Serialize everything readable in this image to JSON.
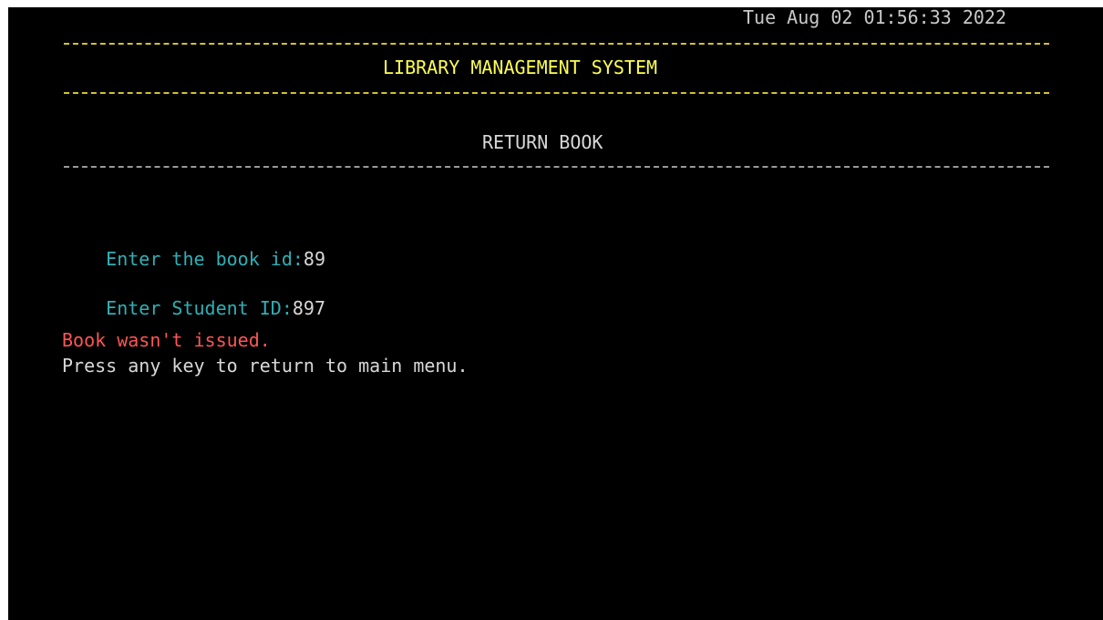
{
  "header": {
    "datetime": "Tue Aug 02 01:56:33 2022",
    "app_title": "LIBRARY MANAGEMENT SYSTEM",
    "screen_title": "RETURN BOOK"
  },
  "form": {
    "book_id_prompt": "Enter the book id:",
    "book_id_value": "89",
    "student_id_prompt": "Enter Student ID:",
    "student_id_value": "897"
  },
  "messages": {
    "error": "Book wasn't issued.",
    "continue_prompt": "Press any key to return to main menu."
  },
  "colors": {
    "background": "#000000",
    "title": "#ffff55",
    "prompt": "#2fb0b6",
    "error": "#ff5555",
    "text": "#d8d8d8"
  }
}
